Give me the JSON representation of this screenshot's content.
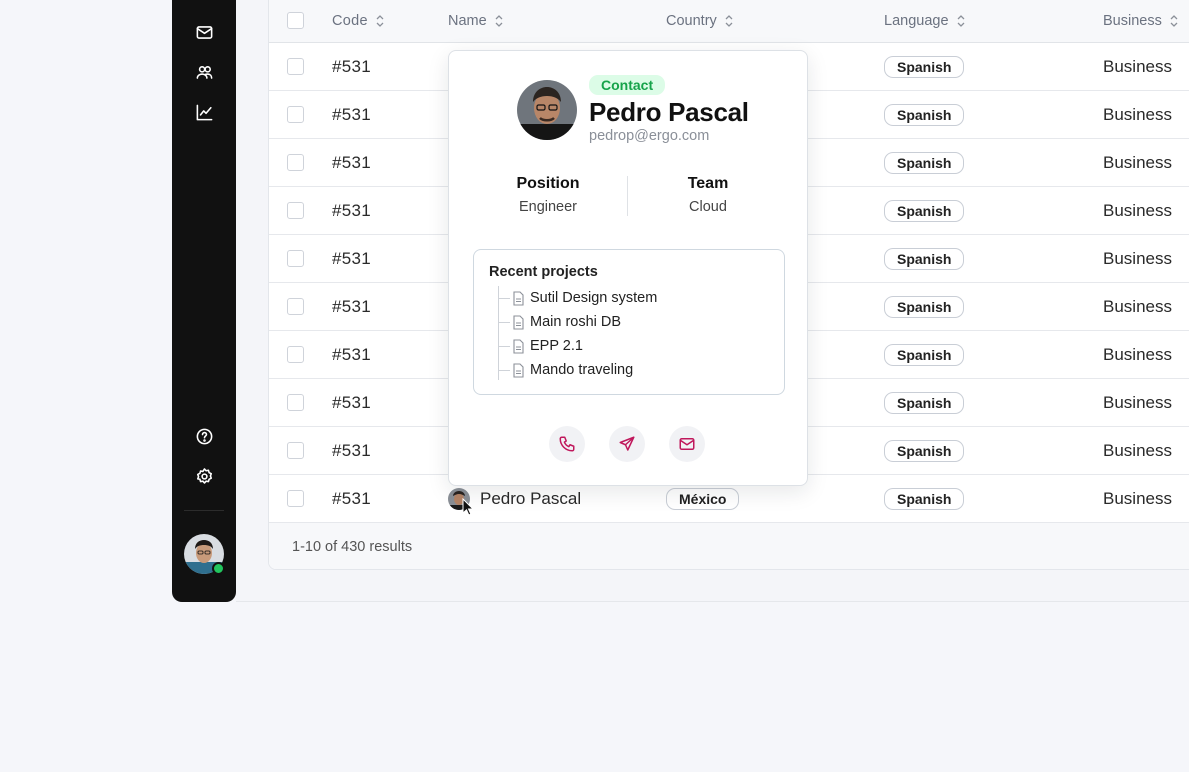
{
  "colors": {
    "sidebar_bg": "#111111",
    "accent": "#c0185c",
    "badge_green": "#16a34a",
    "online": "#22c55e"
  },
  "sidebar": {
    "icons": [
      "mail-icon",
      "users-icon",
      "chart-icon",
      "help-icon",
      "settings-icon"
    ]
  },
  "table": {
    "columns": {
      "code": "Code",
      "name": "Name",
      "country": "Country",
      "language": "Language",
      "business": "Business"
    },
    "rows": [
      {
        "code": "#531",
        "language": "Spanish",
        "business": "Business"
      },
      {
        "code": "#531",
        "language": "Spanish",
        "business": "Business"
      },
      {
        "code": "#531",
        "language": "Spanish",
        "business": "Business"
      },
      {
        "code": "#531",
        "language": "Spanish",
        "business": "Business"
      },
      {
        "code": "#531",
        "language": "Spanish",
        "business": "Business"
      },
      {
        "code": "#531",
        "language": "Spanish",
        "business": "Business"
      },
      {
        "code": "#531",
        "language": "Spanish",
        "business": "Business"
      },
      {
        "code": "#531",
        "language": "Spanish",
        "business": "Business"
      },
      {
        "code": "#531",
        "language": "Spanish",
        "business": "Business"
      },
      {
        "code": "#531",
        "name": "Pedro Pascal",
        "country": "México",
        "language": "Spanish",
        "business": "Business"
      }
    ],
    "footer": "1-10 of 430 results"
  },
  "popover": {
    "badge": "Contact",
    "name": "Pedro Pascal",
    "email": "pedrop@ergo.com",
    "position_label": "Position",
    "position_value": "Engineer",
    "team_label": "Team",
    "team_value": "Cloud",
    "projects_title": "Recent projects",
    "projects": [
      "Sutil Design system",
      "Main roshi DB",
      "EPP 2.1",
      "Mando traveling"
    ]
  }
}
